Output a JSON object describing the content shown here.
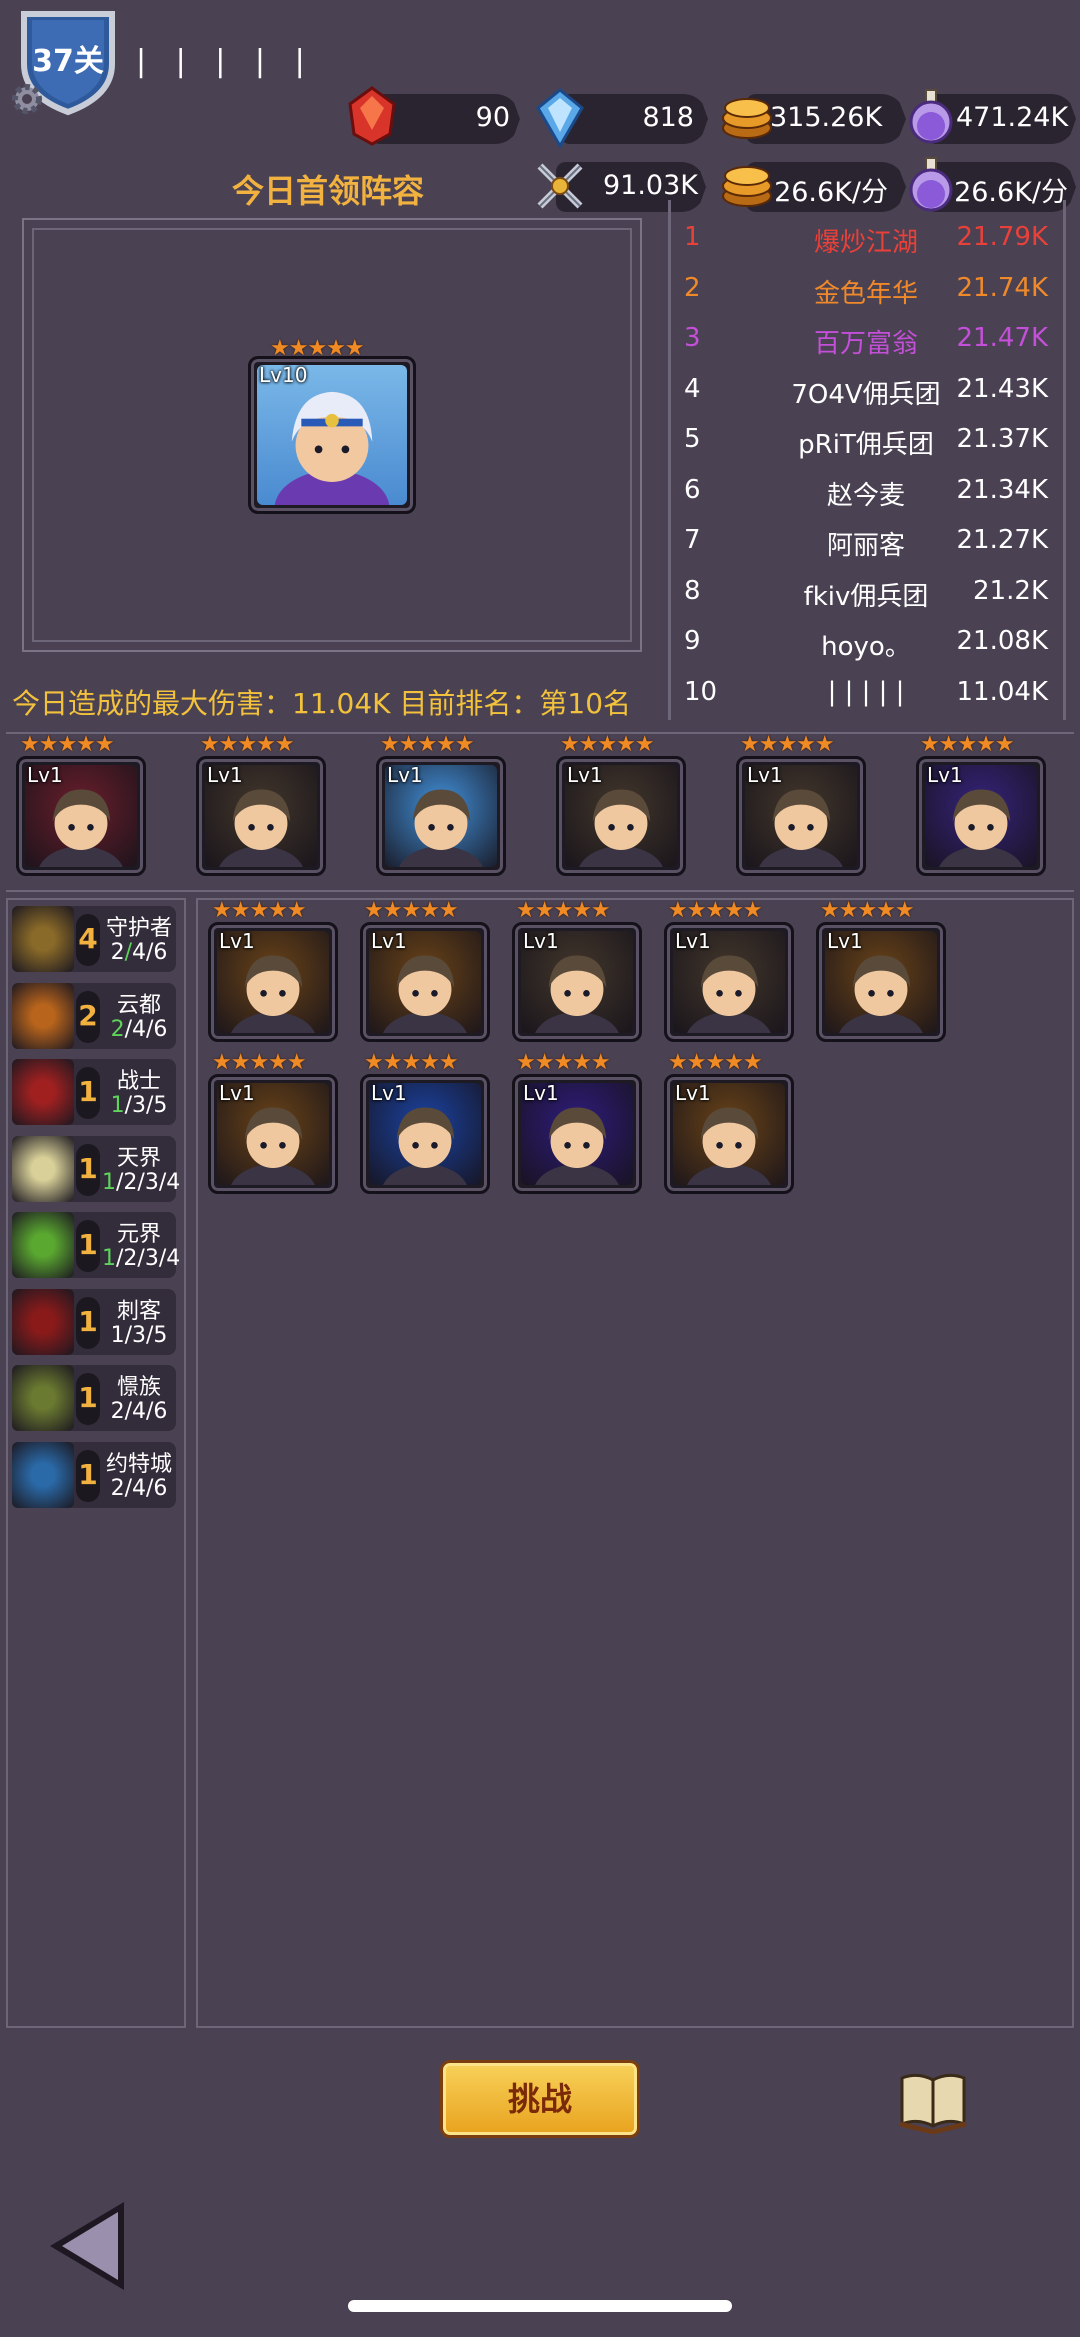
{
  "level": {
    "label": "37关",
    "name_bars": "| | | | |"
  },
  "resources": {
    "red_gem": "90",
    "blue_gem": "818",
    "gold": "315.26K",
    "potion": "471.24K",
    "power": "91.03K",
    "gold_rate": "26.6K/分",
    "potion_rate": "26.6K/分"
  },
  "boss": {
    "title": "今日首领阵容",
    "hero_level": "Lv10",
    "stars": "★★★★★"
  },
  "ranking": [
    {
      "rank": "1",
      "name": "爆炒江湖",
      "score": "21.79K",
      "color": "#e8413a"
    },
    {
      "rank": "2",
      "name": "金色年华",
      "score": "21.74K",
      "color": "#f0892a"
    },
    {
      "rank": "3",
      "name": "百万富翁",
      "score": "21.47K",
      "color": "#c44fd8"
    },
    {
      "rank": "4",
      "name": "7O4V佣兵团",
      "score": "21.43K",
      "color": "#ffffff"
    },
    {
      "rank": "5",
      "name": "pRiT佣兵团",
      "score": "21.37K",
      "color": "#ffffff"
    },
    {
      "rank": "6",
      "name": "赵今麦",
      "score": "21.34K",
      "color": "#ffffff"
    },
    {
      "rank": "7",
      "name": "阿丽客",
      "score": "21.27K",
      "color": "#ffffff"
    },
    {
      "rank": "8",
      "name": "fkiv佣兵团",
      "score": "21.2K",
      "color": "#ffffff"
    },
    {
      "rank": "9",
      "name": "hoyo。",
      "score": "21.08K",
      "color": "#ffffff"
    },
    {
      "rank": "10",
      "name": "| | | | |",
      "score": "11.04K",
      "color": "#ffffff"
    }
  ],
  "damage_summary": "今日造成的最大伤害：11.04K  目前排名：第10名",
  "team": [
    {
      "lv": "Lv1",
      "bg": "#5a1c28",
      "stars": "★★★★★"
    },
    {
      "lv": "Lv1",
      "bg": "#3a3028",
      "stars": "★★★★★"
    },
    {
      "lv": "Lv1",
      "bg": "#3a7ab8",
      "stars": "★★★★★"
    },
    {
      "lv": "Lv1",
      "bg": "#3a3028",
      "stars": "★★★★★"
    },
    {
      "lv": "Lv1",
      "bg": "#3a3028",
      "stars": "★★★★★"
    },
    {
      "lv": "Lv1",
      "bg": "#30206a",
      "stars": "★★★★★"
    }
  ],
  "bench": [
    {
      "lv": "Lv1",
      "bg": "#5a3a18",
      "stars": "★★★★★"
    },
    {
      "lv": "Lv1",
      "bg": "#5a3a18",
      "stars": "★★★★★"
    },
    {
      "lv": "Lv1",
      "bg": "#3a3028",
      "stars": "★★★★★"
    },
    {
      "lv": "Lv1",
      "bg": "#3a3028",
      "stars": "★★★★★"
    },
    {
      "lv": "Lv1",
      "bg": "#5a3a18",
      "stars": "★★★★★"
    },
    {
      "lv": "Lv1",
      "bg": "#5a3a18",
      "stars": "★★★★★"
    },
    {
      "lv": "Lv1",
      "bg": "#1a3a8a",
      "stars": "★★★★★"
    },
    {
      "lv": "Lv1",
      "bg": "#2a1a6a",
      "stars": "★★★★★"
    },
    {
      "lv": "Lv1",
      "bg": "#5a3a18",
      "stars": "★★★★★"
    }
  ],
  "traits": [
    {
      "name": "守护者",
      "count": "4",
      "levels": [
        "2",
        "/",
        "4",
        "/6"
      ],
      "icon_color": "#8a6a28",
      "icon": "shield-icon"
    },
    {
      "name": "云都",
      "count": "2",
      "levels": [
        "",
        "2",
        "/4/6",
        ""
      ],
      "icon_color": "#b8641c",
      "icon": "helmet-icon"
    },
    {
      "name": "战士",
      "count": "1",
      "levels": [
        "",
        "1",
        "/3/5",
        ""
      ],
      "icon_color": "#a02020",
      "icon": "sword-icon"
    },
    {
      "name": "天界",
      "count": "1",
      "levels": [
        "",
        "1",
        "/2/3/4",
        ""
      ],
      "icon_color": "#d8d098",
      "icon": "light-icon"
    },
    {
      "name": "元界",
      "count": "1",
      "levels": [
        "",
        "1",
        "/2/3/4",
        ""
      ],
      "icon_color": "#5aa830",
      "icon": "energy-icon"
    },
    {
      "name": "刺客",
      "count": "1",
      "levels": [
        "",
        "",
        "1/3/5",
        ""
      ],
      "icon_color": "#8a1a1a",
      "icon": "blade-icon"
    },
    {
      "name": "憬族",
      "count": "1",
      "levels": [
        "",
        "",
        "2/4/6",
        ""
      ],
      "icon_color": "#6a7a30",
      "icon": "lightning-icon"
    },
    {
      "name": "约特城",
      "count": "1",
      "levels": [
        "",
        "",
        "2/4/6",
        ""
      ],
      "icon_color": "#2a6aa8",
      "icon": "vortex-icon"
    }
  ],
  "actions": {
    "challenge": "挑战"
  }
}
